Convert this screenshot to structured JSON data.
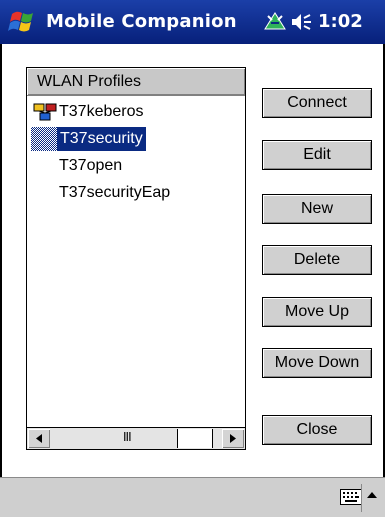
{
  "titlebar": {
    "app_title": "Mobile Companion",
    "clock": "1:02"
  },
  "icons": {
    "start": "windows-flag-icon",
    "connectivity": "connectivity-icon",
    "volume": "speaker-icon",
    "keyboard": "keyboard-icon",
    "input_menu": "arrow-up-icon",
    "profile": "network-profile-icon"
  },
  "list": {
    "header": "WLAN Profiles",
    "items": [
      {
        "label": "T37keberos",
        "icon": "network-profile-icon",
        "selected": false
      },
      {
        "label": "T37security",
        "selected": true
      },
      {
        "label": "T37open",
        "selected": false
      },
      {
        "label": "T37securityEap",
        "selected": false
      }
    ],
    "scrollbar": {
      "left": "◄",
      "grip": "III",
      "right": "►"
    }
  },
  "buttons": {
    "connect": "Connect",
    "edit": "Edit",
    "new": "New",
    "delete": "Delete",
    "move_up": "Move Up",
    "move_down": "Move Down",
    "close": "Close"
  },
  "colors": {
    "titlebar": "#0a2a82",
    "selection": "#0a2a82",
    "button_face": "#d0d0d0"
  }
}
